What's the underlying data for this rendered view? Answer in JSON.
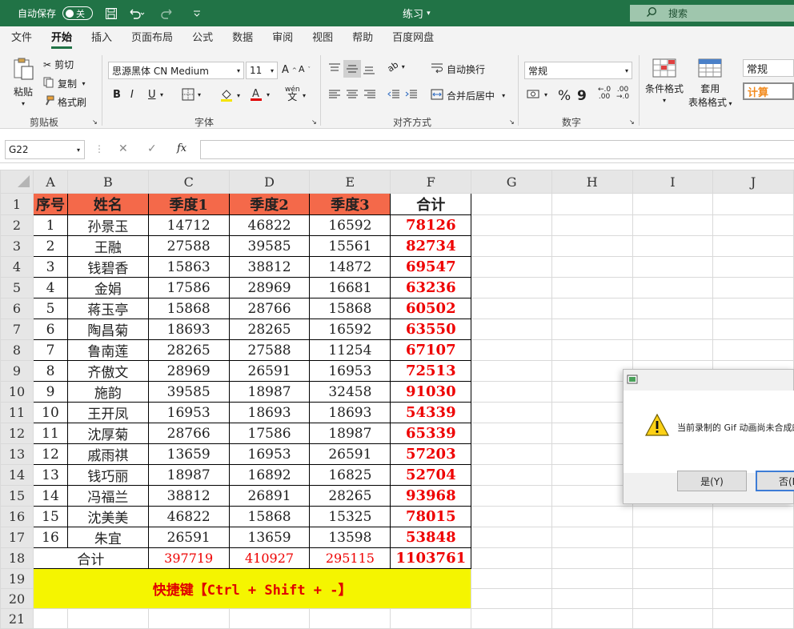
{
  "titlebar": {
    "autosave_label": "自动保存",
    "autosave_state": "关",
    "doc_title": "练习",
    "search_placeholder": "搜索"
  },
  "tabs": [
    "文件",
    "开始",
    "插入",
    "页面布局",
    "公式",
    "数据",
    "审阅",
    "视图",
    "帮助",
    "百度网盘"
  ],
  "ribbon": {
    "clipboard": {
      "paste": "粘贴",
      "cut": "剪切",
      "copy": "复制",
      "format_painter": "格式刷",
      "group": "剪贴板"
    },
    "font": {
      "family": "思源黑体 CN Medium",
      "size": "11",
      "bold": "B",
      "italic": "I",
      "underline": "U",
      "group": "字体"
    },
    "alignment": {
      "wrap": "自动换行",
      "merge": "合并后居中",
      "group": "对齐方式"
    },
    "number": {
      "format": "常规",
      "percent": "%",
      "comma": "9",
      "group": "数字"
    },
    "styles": {
      "conditional": "条件格式",
      "table_format_1": "套用",
      "table_format_2": "表格格式",
      "style_normal": "常规",
      "style_calc": "计算"
    }
  },
  "formula_bar": {
    "name_box": "G22",
    "fx": "fx",
    "content": ""
  },
  "columns": [
    "A",
    "B",
    "C",
    "D",
    "E",
    "F",
    "G",
    "H",
    "I",
    "J"
  ],
  "table": {
    "headers": [
      "序号",
      "姓名",
      "季度1",
      "季度2",
      "季度3",
      "合计"
    ],
    "rows": [
      [
        "1",
        "孙景玉",
        "14712",
        "46822",
        "16592",
        "78126"
      ],
      [
        "2",
        "王融",
        "27588",
        "39585",
        "15561",
        "82734"
      ],
      [
        "3",
        "钱碧香",
        "15863",
        "38812",
        "14872",
        "69547"
      ],
      [
        "4",
        "金娟",
        "17586",
        "28969",
        "16681",
        "63236"
      ],
      [
        "5",
        "蒋玉亭",
        "15868",
        "28766",
        "15868",
        "60502"
      ],
      [
        "6",
        "陶昌菊",
        "18693",
        "28265",
        "16592",
        "63550"
      ],
      [
        "7",
        "鲁南莲",
        "28265",
        "27588",
        "11254",
        "67107"
      ],
      [
        "8",
        "齐傲文",
        "28969",
        "26591",
        "16953",
        "72513"
      ],
      [
        "9",
        "施韵",
        "39585",
        "18987",
        "32458",
        "91030"
      ],
      [
        "10",
        "王开凤",
        "16953",
        "18693",
        "18693",
        "54339"
      ],
      [
        "11",
        "沈厚菊",
        "28766",
        "17586",
        "18987",
        "65339"
      ],
      [
        "12",
        "戚雨祺",
        "13659",
        "16953",
        "26591",
        "57203"
      ],
      [
        "13",
        "钱巧丽",
        "18987",
        "16892",
        "16825",
        "52704"
      ],
      [
        "14",
        "冯福兰",
        "38812",
        "26891",
        "28265",
        "93968"
      ],
      [
        "15",
        "沈美美",
        "46822",
        "15868",
        "15325",
        "78015"
      ],
      [
        "16",
        "朱宜",
        "26591",
        "13659",
        "13598",
        "53848"
      ]
    ],
    "total_label": "合计",
    "totals": [
      "397719",
      "410927",
      "295115",
      "1103761"
    ],
    "hint": "快捷键【Ctrl + Shift + -】"
  },
  "dialog": {
    "message": "当前录制的 Gif 动画尚未合成的",
    "yes": "是(Y)",
    "no": "否(N"
  }
}
